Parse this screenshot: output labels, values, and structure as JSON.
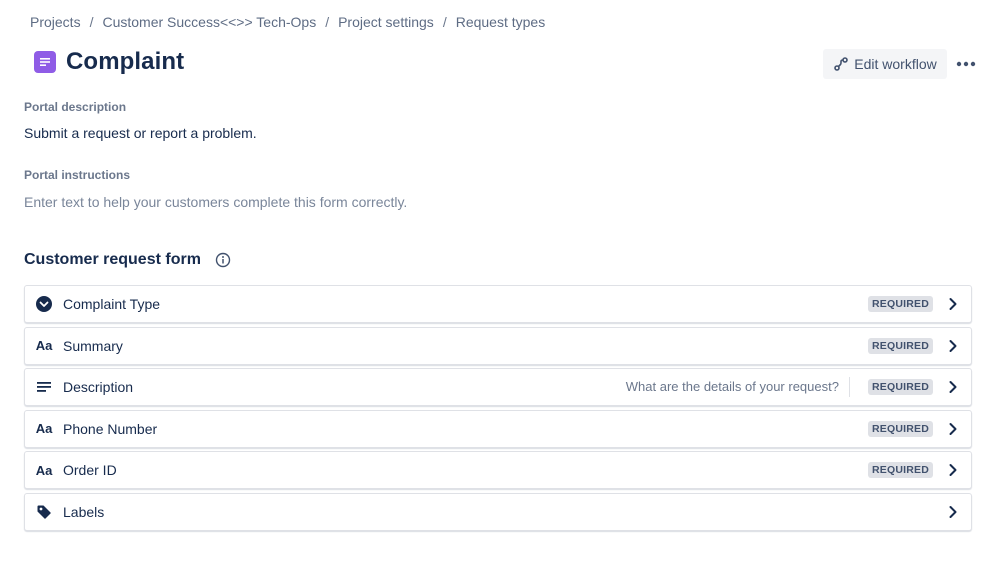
{
  "breadcrumb": {
    "items": [
      "Projects",
      "Customer Success<<>> Tech-Ops",
      "Project settings",
      "Request types"
    ],
    "separator": "/"
  },
  "header": {
    "title": "Complaint",
    "icon": "request-type-document-icon",
    "icon_color": "#8f5ce6",
    "edit_workflow_label": "Edit workflow",
    "more_icon": "more-horizontal-icon"
  },
  "portal": {
    "description_label": "Portal description",
    "description_value": "Submit a request or report a problem.",
    "instructions_label": "Portal instructions",
    "instructions_placeholder": "Enter text to help your customers complete this form correctly."
  },
  "form": {
    "title": "Customer request form",
    "info_icon": "info-icon",
    "fields": [
      {
        "label": "Complaint Type",
        "icon": "select-dropdown-icon",
        "hint": "",
        "badge": "REQUIRED"
      },
      {
        "label": "Summary",
        "icon": "text-field-icon",
        "hint": "",
        "badge": "REQUIRED"
      },
      {
        "label": "Description",
        "icon": "paragraph-icon",
        "hint": "What are the details of your request?",
        "badge": "REQUIRED"
      },
      {
        "label": "Phone Number",
        "icon": "text-field-icon",
        "hint": "",
        "badge": "REQUIRED"
      },
      {
        "label": "Order ID",
        "icon": "text-field-icon",
        "hint": "",
        "badge": "REQUIRED"
      },
      {
        "label": "Labels",
        "icon": "label-tag-icon",
        "hint": "",
        "badge": ""
      }
    ],
    "text_icon_glyph": "Aa"
  },
  "colors": {
    "text_primary": "#172b4d",
    "text_subtle": "#6b778c",
    "badge_bg": "#dfe1e6",
    "border": "#dfe1e6"
  }
}
